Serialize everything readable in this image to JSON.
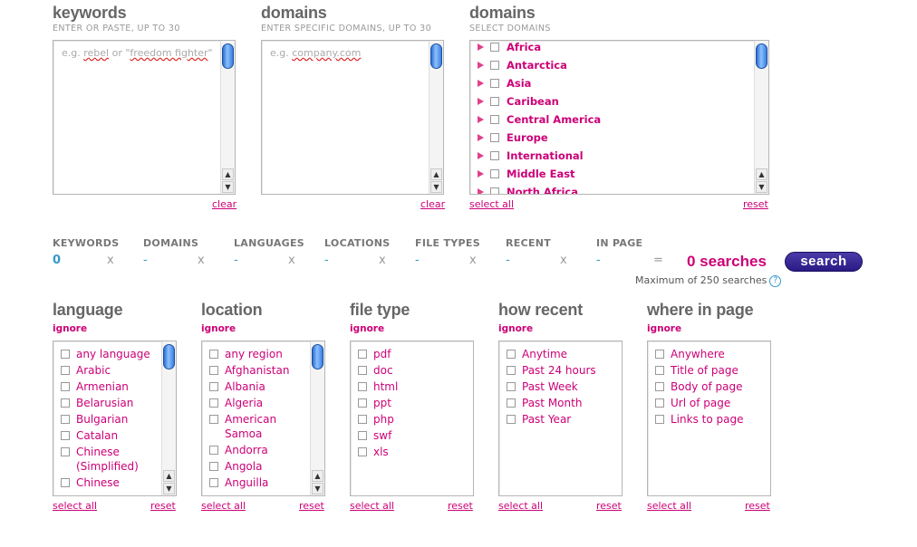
{
  "keywords": {
    "title": "keywords",
    "subtitle": "ENTER OR PASTE, UP TO 30",
    "placeholder_parts": [
      "e.g. ",
      "rebel",
      " or \"",
      "freedom fighter",
      "\""
    ],
    "clear_label": "clear"
  },
  "domains_input": {
    "title": "domains",
    "subtitle": "ENTER SPECIFIC DOMAINS, UP TO 30",
    "placeholder_parts": [
      "e.g. ",
      "company.com"
    ],
    "clear_label": "clear"
  },
  "domains_select": {
    "title": "domains",
    "subtitle": "SELECT DOMAINS",
    "items": [
      "Africa",
      "Antarctica",
      "Asia",
      "Caribean",
      "Central America",
      "Europe",
      "International",
      "Middle East",
      "North Africa"
    ],
    "select_all_label": "select all",
    "reset_label": "reset"
  },
  "summary": {
    "headers": [
      "KEYWORDS",
      "DOMAINS",
      "LANGUAGES",
      "LOCATIONS",
      "FILE TYPES",
      "RECENT",
      "IN PAGE"
    ],
    "values": [
      "0",
      "-",
      "-",
      "-",
      "-",
      "-",
      "-"
    ],
    "multiplier": "x",
    "equals": "=",
    "searches_text": "0 searches",
    "search_button": "search",
    "max_note": "Maximum of 250 searches",
    "help_icon": "?"
  },
  "filters": [
    {
      "title": "language",
      "ignore": "ignore",
      "options": [
        "any language",
        "Arabic",
        "Armenian",
        "Belarusian",
        "Bulgarian",
        "Catalan",
        "Chinese (Simplified)",
        "Chinese"
      ],
      "scroll": true,
      "select_all_label": "select all",
      "reset_label": "reset"
    },
    {
      "title": "location",
      "ignore": "ignore",
      "options": [
        "any region",
        "Afghanistan",
        "Albania",
        "Algeria",
        "American Samoa",
        "Andorra",
        "Angola",
        "Anguilla"
      ],
      "scroll": true,
      "select_all_label": "select all",
      "reset_label": "reset"
    },
    {
      "title": "file type",
      "ignore": "ignore",
      "options": [
        "pdf",
        "doc",
        "html",
        "ppt",
        "php",
        "swf",
        "xls"
      ],
      "scroll": false,
      "select_all_label": "select all",
      "reset_label": "reset"
    },
    {
      "title": "how recent",
      "ignore": "ignore",
      "options": [
        "Anytime",
        "Past 24 hours",
        "Past Week",
        "Past Month",
        "Past Year"
      ],
      "scroll": false,
      "select_all_label": "select all",
      "reset_label": "reset"
    },
    {
      "title": "where in page",
      "ignore": "ignore",
      "options": [
        "Anywhere",
        "Title of page",
        "Body of page",
        "Url of page",
        "Links to page"
      ],
      "scroll": false,
      "select_all_label": "select all",
      "reset_label": "reset"
    }
  ],
  "colors": {
    "accent": "#cc0077",
    "summary_value": "#3399cc",
    "button": "#2a1a85"
  }
}
